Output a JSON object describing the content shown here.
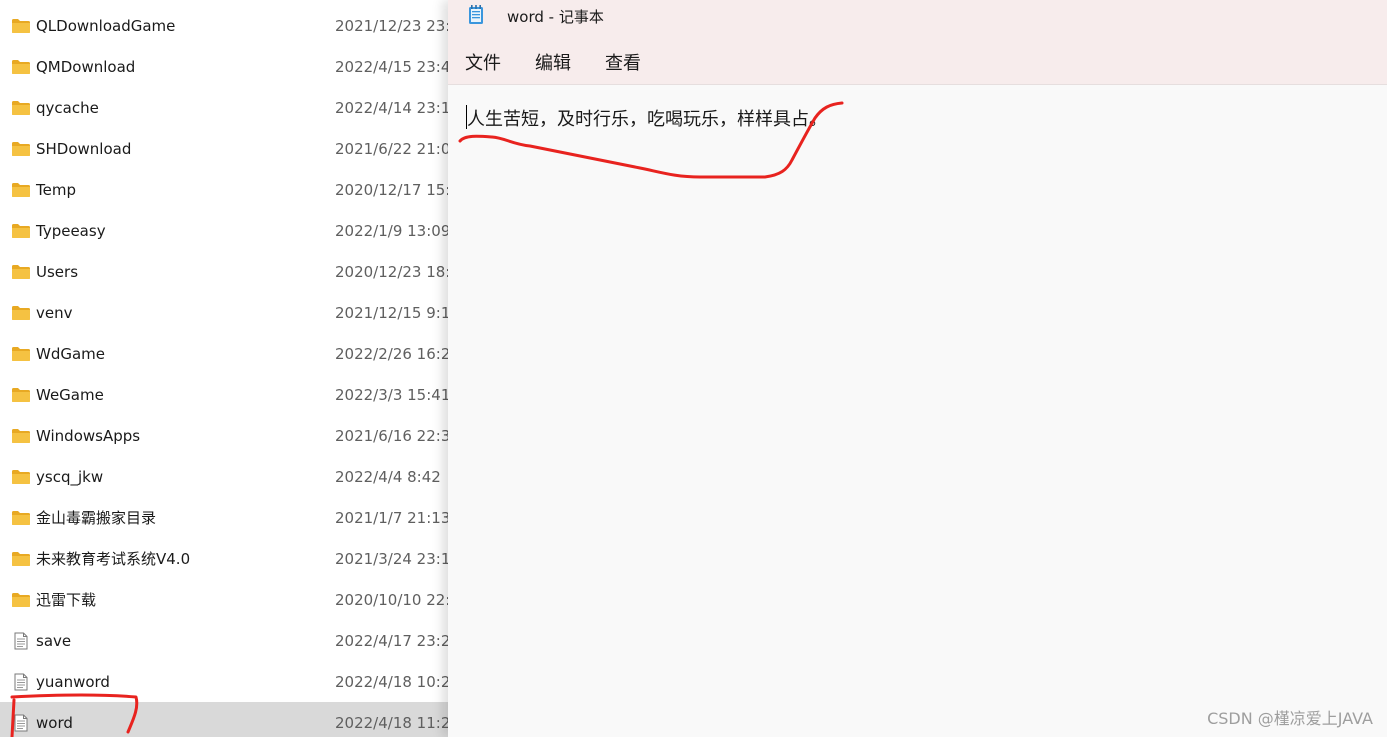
{
  "explorer": {
    "rows": [
      {
        "name": "QLDownloadGame",
        "date": "2021/12/23 23:",
        "type": "folder"
      },
      {
        "name": "QMDownload",
        "date": "2022/4/15 23:4",
        "type": "folder"
      },
      {
        "name": "qycache",
        "date": "2022/4/14 23:1",
        "type": "folder"
      },
      {
        "name": "SHDownload",
        "date": "2021/6/22 21:0",
        "type": "folder"
      },
      {
        "name": "Temp",
        "date": "2020/12/17 15:",
        "type": "folder"
      },
      {
        "name": "Typeeasy",
        "date": "2022/1/9 13:09",
        "type": "folder"
      },
      {
        "name": "Users",
        "date": "2020/12/23 18:",
        "type": "folder"
      },
      {
        "name": "venv",
        "date": "2021/12/15 9:1",
        "type": "folder"
      },
      {
        "name": "WdGame",
        "date": "2022/2/26 16:2",
        "type": "folder"
      },
      {
        "name": "WeGame",
        "date": "2022/3/3 15:41",
        "type": "folder"
      },
      {
        "name": "WindowsApps",
        "date": "2021/6/16 22:3",
        "type": "folder"
      },
      {
        "name": "yscq_jkw",
        "date": "2022/4/4 8:42",
        "type": "folder"
      },
      {
        "name": "金山毒霸搬家目录",
        "date": "2021/1/7 21:13",
        "type": "folder"
      },
      {
        "name": "未来教育考试系统V4.0",
        "date": "2021/3/24 23:1",
        "type": "folder"
      },
      {
        "name": "迅雷下载",
        "date": "2020/10/10 22:",
        "type": "folder"
      },
      {
        "name": "save",
        "date": "2022/4/17 23:2",
        "type": "file"
      },
      {
        "name": "yuanword",
        "date": "2022/4/18 10:2",
        "type": "file"
      },
      {
        "name": "word",
        "date": "2022/4/18 11:2",
        "type": "file",
        "selected": true
      }
    ]
  },
  "notepad": {
    "title": "word - 记事本",
    "menu": {
      "file": "文件",
      "edit": "编辑",
      "view": "查看"
    },
    "content": "人生苦短，及时行乐，吃喝玩乐，样样具占。"
  },
  "watermark": "CSDN @槿凉爱上JAVA",
  "colors": {
    "folder": "#f5c242",
    "annotation": "#e8231f",
    "selected_row": "#d9d9d9",
    "notepad_chrome": "#f7ecec"
  }
}
